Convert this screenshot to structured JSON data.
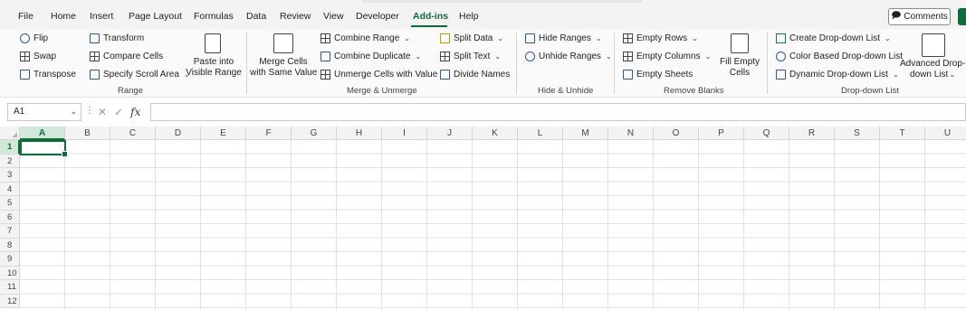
{
  "menu": [
    "File",
    "Home",
    "Insert",
    "Page Layout",
    "Formulas",
    "Data",
    "Review",
    "View",
    "Developer",
    "Add-ins",
    "Help"
  ],
  "active_tab": "Add-ins",
  "comments_label": "Comments",
  "ribbon": {
    "range": {
      "flip": "Flip",
      "swap": "Swap",
      "transpose": "Transpose",
      "transform": "Transform",
      "compare": "Compare Cells",
      "scroll": "Specify Scroll Area",
      "paste1": "Paste into",
      "paste2": "Visible Range",
      "group": "Range"
    },
    "merge": {
      "big1": "Merge Cells",
      "big2": "with Same Value",
      "combine_range": "Combine Range",
      "combine_dup": "Combine Duplicate",
      "unmerge": "Unmerge Cells with Value",
      "split_data": "Split Data",
      "split_text": "Split Text",
      "divide": "Divide Names",
      "group": "Merge & Unmerge"
    },
    "hide": {
      "hide_ranges": "Hide Ranges",
      "unhide_ranges": "Unhide Ranges",
      "group": "Hide & Unhide"
    },
    "blanks": {
      "rows": "Empty Rows",
      "cols": "Empty Columns",
      "sheets": "Empty Sheets",
      "fill1": "Fill Empty",
      "fill2": "Cells",
      "group": "Remove Blanks"
    },
    "dropdown": {
      "create": "Create Drop-down List",
      "color": "Color Based Drop-down List",
      "dynamic": "Dynamic Drop-down List",
      "adv1": "Advanced Drop-",
      "adv2": "down List",
      "group": "Drop-down List"
    }
  },
  "formula_bar": {
    "name_box": "A1",
    "fx": "fx",
    "value": ""
  },
  "columns": [
    "A",
    "B",
    "C",
    "D",
    "E",
    "F",
    "G",
    "H",
    "I",
    "J",
    "K",
    "L",
    "M",
    "N",
    "O",
    "P",
    "Q",
    "R",
    "S",
    "T",
    "U"
  ],
  "rows": [
    "1",
    "2",
    "3",
    "4",
    "5",
    "6",
    "7",
    "8",
    "9",
    "10",
    "11",
    "12"
  ],
  "selected_cell": "A1"
}
